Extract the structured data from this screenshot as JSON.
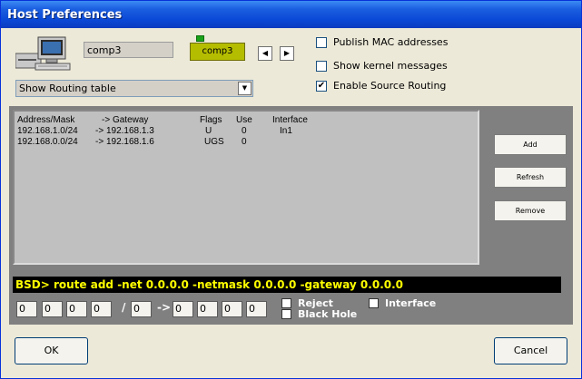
{
  "window": {
    "title": "Host Preferences",
    "behind_fragment": ""
  },
  "host": {
    "name_value": "comp3",
    "button_label": "comp3",
    "prev_symbol": "◀",
    "next_symbol": "▶"
  },
  "options": [
    {
      "label": "Publish MAC addresses",
      "checked": false
    },
    {
      "label": "Show kernel messages",
      "checked": false
    },
    {
      "label": "Enable Source Routing",
      "checked": true
    }
  ],
  "view_select": {
    "value": "Show Routing table"
  },
  "routing_table": {
    "headers": {
      "address": "Address/Mask",
      "gateway": "-> Gateway",
      "flags": "Flags",
      "use": "Use",
      "interface": "Interface"
    },
    "rows": [
      {
        "address": "192.168.1.0/24",
        "gateway": "-> 192.168.1.3",
        "flags": "U",
        "use": "0",
        "interface": "In1"
      },
      {
        "address": "192.168.0.0/24",
        "gateway": "-> 192.168.1.6",
        "flags": "UGS",
        "use": "0",
        "interface": ""
      }
    ]
  },
  "actions": {
    "add": "Add",
    "refresh": "Refresh",
    "remove": "Remove"
  },
  "command": "BSD> route add -net 0.0.0.0 -netmask 0.0.0.0 -gateway 0.0.0.0",
  "route_entry": {
    "net": [
      "0",
      "0",
      "0",
      "0"
    ],
    "slash": "/",
    "mask": "0",
    "arrow": "->",
    "gateway": [
      "0",
      "0",
      "0",
      "0"
    ],
    "reject_label": "Reject",
    "blackhole_label": "Black Hole",
    "interface_label": "Interface"
  },
  "footer": {
    "ok": "OK",
    "cancel": "Cancel"
  },
  "colors": {
    "title_bar": "#0a48d6",
    "host_button": "#b5bd00",
    "command_text": "#ffff00",
    "panel": "#808080"
  },
  "icons": [
    "computer-icon",
    "checkmark-icon",
    "dropdown-arrow-icon",
    "left-arrow-icon",
    "right-arrow-icon"
  ]
}
